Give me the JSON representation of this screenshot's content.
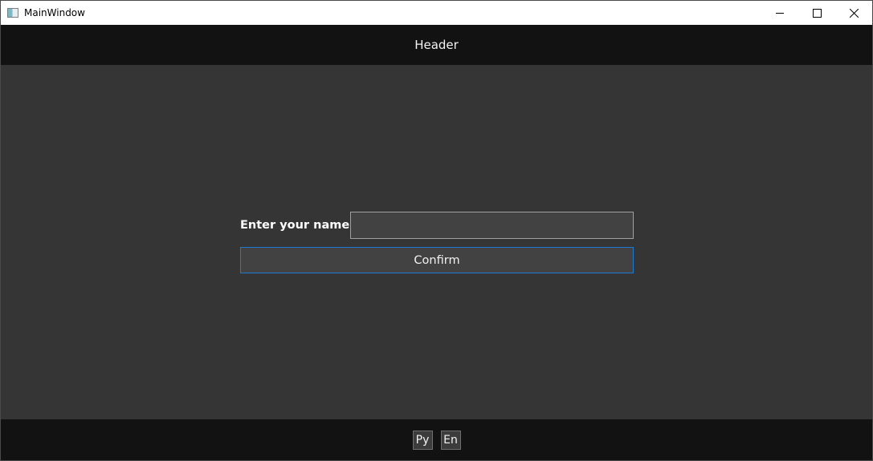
{
  "window": {
    "title": "MainWindow",
    "caption_icons": [
      "minimize-icon",
      "maximize-icon",
      "close-icon"
    ]
  },
  "header": {
    "title": "Header"
  },
  "form": {
    "name_label": "Enter your name:",
    "name_value": "",
    "confirm_label": "Confirm"
  },
  "footer": {
    "languages": [
      "Py",
      "En"
    ]
  },
  "colors": {
    "content_bg": "#353535",
    "bar_bg": "#121212",
    "accent_border": "#1f79d0"
  }
}
